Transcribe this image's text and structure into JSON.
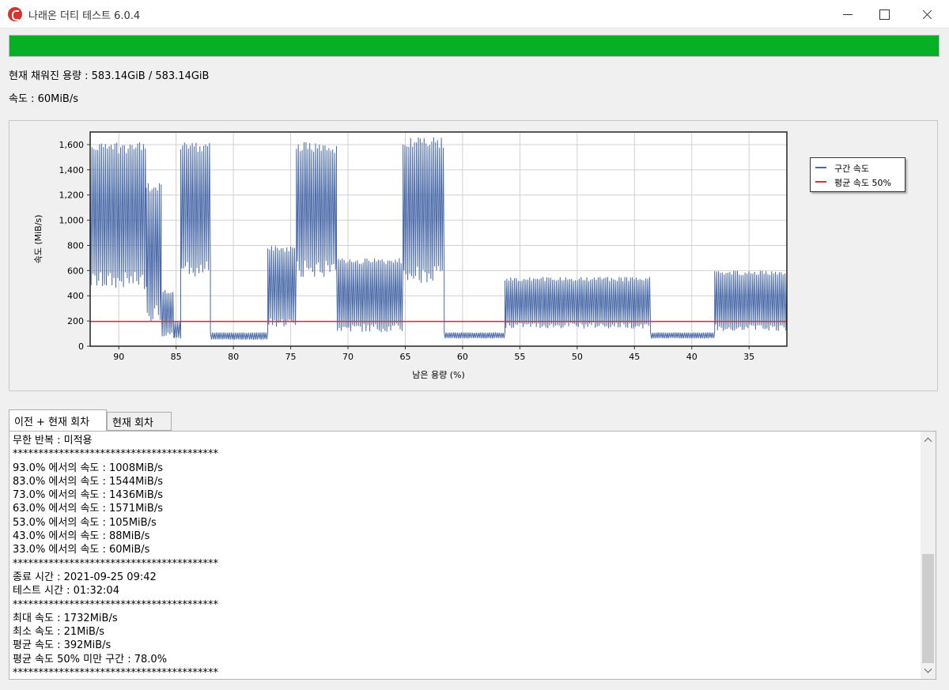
{
  "window": {
    "title": "나래온 더티 테스트 6.0.4"
  },
  "progress": {
    "percent": 100
  },
  "status": {
    "used": "현재 채워진 용량 : 583.14GiB / 583.14GiB",
    "speed": "속도 : 60MiB/s"
  },
  "chart_data": {
    "type": "line",
    "xlabel": "남은 용량 (%)",
    "ylabel": "속도 (MiB/s)",
    "xlim": [
      92.5,
      31.7
    ],
    "ylim": [
      0,
      1700
    ],
    "x_reversed": true,
    "x_ticks": [
      90,
      85,
      80,
      75,
      70,
      65,
      60,
      55,
      50,
      45,
      40,
      35
    ],
    "x_tick_labels": [
      "90",
      "85",
      "80",
      "75",
      "70",
      "65",
      "60",
      "55",
      "50",
      "45",
      "40",
      "35"
    ],
    "y_ticks": [
      0,
      200,
      400,
      600,
      800,
      1000,
      1200,
      1400,
      1600
    ],
    "y_tick_labels": [
      "0",
      "200",
      "400",
      "600",
      "800",
      "1,000",
      "1,200",
      "1,400",
      "1,600"
    ],
    "grid": true,
    "legend_position": "right",
    "colors": {
      "series": "#4a6aa8",
      "average": "#e03030"
    },
    "series": [
      {
        "name": "구간 속도",
        "style": "dense-oscillation",
        "segments": [
          {
            "x": [
              92.5,
              87.6
            ],
            "low": 450,
            "high": 1620
          },
          {
            "x": [
              87.6,
              86.3
            ],
            "low": 200,
            "high": 1300
          },
          {
            "x": [
              86.3,
              85.2
            ],
            "low": 60,
            "high": 450
          },
          {
            "x": [
              85.2,
              84.6
            ],
            "low": 60,
            "high": 200
          },
          {
            "x": [
              84.6,
              82.0
            ],
            "low": 550,
            "high": 1620
          },
          {
            "x": [
              82.0,
              77.0
            ],
            "low": 50,
            "high": 110
          },
          {
            "x": [
              77.0,
              74.5
            ],
            "low": 150,
            "high": 800
          },
          {
            "x": [
              74.5,
              71.0
            ],
            "low": 550,
            "high": 1620
          },
          {
            "x": [
              71.0,
              65.2
            ],
            "low": 110,
            "high": 700
          },
          {
            "x": [
              65.2,
              61.6
            ],
            "low": 500,
            "high": 1660
          },
          {
            "x": [
              61.6,
              56.3
            ],
            "low": 60,
            "high": 110
          },
          {
            "x": [
              56.3,
              43.6
            ],
            "low": 140,
            "high": 550
          },
          {
            "x": [
              43.6,
              38.0
            ],
            "low": 60,
            "high": 110
          },
          {
            "x": [
              38.0,
              31.7
            ],
            "low": 120,
            "high": 600
          }
        ]
      },
      {
        "name": "평균 속도 50%",
        "x": [
          92.5,
          31.7
        ],
        "y": [
          196,
          196
        ]
      }
    ]
  },
  "tabs": [
    {
      "label": "이전 + 현재 회차"
    },
    {
      "label": "현재 회차"
    }
  ],
  "log": {
    "lines": [
      "무한 반복 : 미적용",
      "****************************************",
      "93.0% 에서의 속도 : 1008MiB/s",
      "83.0% 에서의 속도 : 1544MiB/s",
      "73.0% 에서의 속도 : 1436MiB/s",
      "63.0% 에서의 속도 : 1571MiB/s",
      "53.0% 에서의 속도 : 105MiB/s",
      "43.0% 에서의 속도 : 88MiB/s",
      "33.0% 에서의 속도 : 60MiB/s",
      "****************************************",
      "종료 시간 : 2021-09-25 09:42",
      "테스트 시간 : 01:32:04",
      "****************************************",
      "최대 속도 : 1732MiB/s",
      "최소 속도 : 21MiB/s",
      "평균 속도 : 392MiB/s",
      "평균 속도 50% 미만 구간 : 78.0%",
      "****************************************"
    ]
  },
  "icons": {
    "app": "app-logo-icon",
    "minimize": "minimize-icon",
    "maximize": "maximize-icon",
    "close": "close-icon",
    "scroll_up": "chevron-up-icon",
    "scroll_down": "chevron-down-icon"
  }
}
